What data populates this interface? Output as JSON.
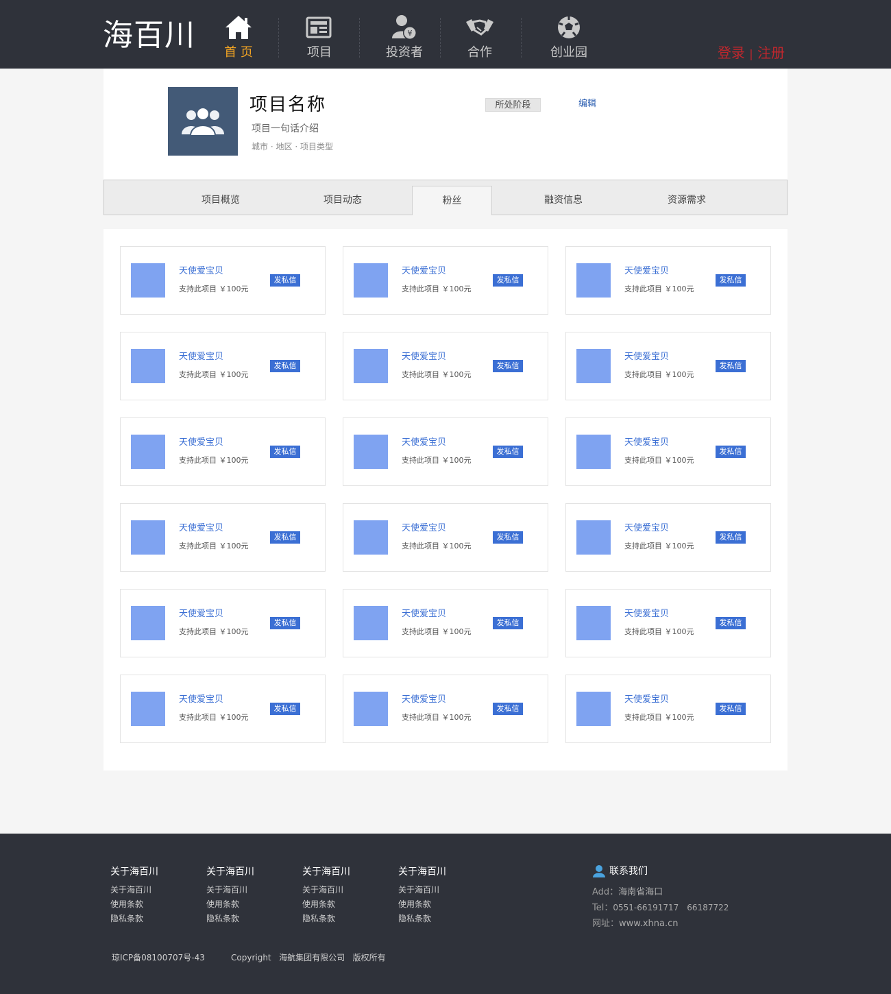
{
  "header": {
    "logo": "海百川",
    "nav": [
      {
        "label": "首 页",
        "icon": "home-icon",
        "active": true
      },
      {
        "label": "项目",
        "icon": "news-icon",
        "active": false
      },
      {
        "label": "投资者",
        "icon": "investor-icon",
        "active": false
      },
      {
        "label": "合作",
        "icon": "handshake-icon",
        "active": false
      },
      {
        "label": "创业园",
        "icon": "soccer-ball-icon",
        "active": false
      }
    ],
    "login": "登录",
    "divider": "|",
    "register": "注册"
  },
  "project": {
    "name": "项目名称",
    "intro": "项目一句话介绍",
    "city": "城市",
    "region": "地区",
    "type": "项目类型",
    "meta_dot": "·",
    "stage": "所处阶段",
    "edit": "编辑"
  },
  "tabs": [
    {
      "label": "项目概览",
      "active": false
    },
    {
      "label": "项目动态",
      "active": false
    },
    {
      "label": "粉丝",
      "active": true
    },
    {
      "label": "融资信息",
      "active": false
    },
    {
      "label": "资源需求",
      "active": false
    }
  ],
  "fans": {
    "items": [
      {
        "name": "天使爱宝贝",
        "support": "支持此项目 ￥100元",
        "action": "发私信"
      },
      {
        "name": "天使爱宝贝",
        "support": "支持此项目 ￥100元",
        "action": "发私信"
      },
      {
        "name": "天使爱宝贝",
        "support": "支持此项目 ￥100元",
        "action": "发私信"
      },
      {
        "name": "天使爱宝贝",
        "support": "支持此项目 ￥100元",
        "action": "发私信"
      },
      {
        "name": "天使爱宝贝",
        "support": "支持此项目 ￥100元",
        "action": "发私信"
      },
      {
        "name": "天使爱宝贝",
        "support": "支持此项目 ￥100元",
        "action": "发私信"
      },
      {
        "name": "天使爱宝贝",
        "support": "支持此项目 ￥100元",
        "action": "发私信"
      },
      {
        "name": "天使爱宝贝",
        "support": "支持此项目 ￥100元",
        "action": "发私信"
      },
      {
        "name": "天使爱宝贝",
        "support": "支持此项目 ￥100元",
        "action": "发私信"
      },
      {
        "name": "天使爱宝贝",
        "support": "支持此项目 ￥100元",
        "action": "发私信"
      },
      {
        "name": "天使爱宝贝",
        "support": "支持此项目 ￥100元",
        "action": "发私信"
      },
      {
        "name": "天使爱宝贝",
        "support": "支持此项目 ￥100元",
        "action": "发私信"
      },
      {
        "name": "天使爱宝贝",
        "support": "支持此项目 ￥100元",
        "action": "发私信"
      },
      {
        "name": "天使爱宝贝",
        "support": "支持此项目 ￥100元",
        "action": "发私信"
      },
      {
        "name": "天使爱宝贝",
        "support": "支持此项目 ￥100元",
        "action": "发私信"
      },
      {
        "name": "天使爱宝贝",
        "support": "支持此项目 ￥100元",
        "action": "发私信"
      },
      {
        "name": "天使爱宝贝",
        "support": "支持此项目 ￥100元",
        "action": "发私信"
      },
      {
        "name": "天使爱宝贝",
        "support": "支持此项目 ￥100元",
        "action": "发私信"
      }
    ]
  },
  "footer": {
    "columns": [
      {
        "title": "关于海百川",
        "links": [
          "关于海百川",
          "使用条款",
          "隐私条款"
        ]
      },
      {
        "title": "关于海百川",
        "links": [
          "关于海百川",
          "使用条款",
          "隐私条款"
        ]
      },
      {
        "title": "关于海百川",
        "links": [
          "关于海百川",
          "使用条款",
          "隐私条款"
        ]
      },
      {
        "title": "关于海百川",
        "links": [
          "关于海百川",
          "使用条款",
          "隐私条款"
        ]
      }
    ],
    "contact": {
      "title": "联系我们",
      "icon": "user-icon",
      "address_label": "Add：",
      "address": "海南省海口",
      "tel_label": "Tel：",
      "tel1": "0551-66191717",
      "tel2": "66187722",
      "site_label": "网址：",
      "site": "www.xhna.cn"
    },
    "icp": "琼ICP备08100707号-43",
    "copyright": "Copyright",
    "company": "海航集团有限公司",
    "rights": "版权所有"
  },
  "colors": {
    "header_bg": "#2f323a",
    "nav_active": "#f5a623",
    "auth": "#c0272d",
    "link_blue": "#3b6fd4",
    "fan_avatar": "#7fa3f1",
    "project_avatar": "#435a77"
  }
}
